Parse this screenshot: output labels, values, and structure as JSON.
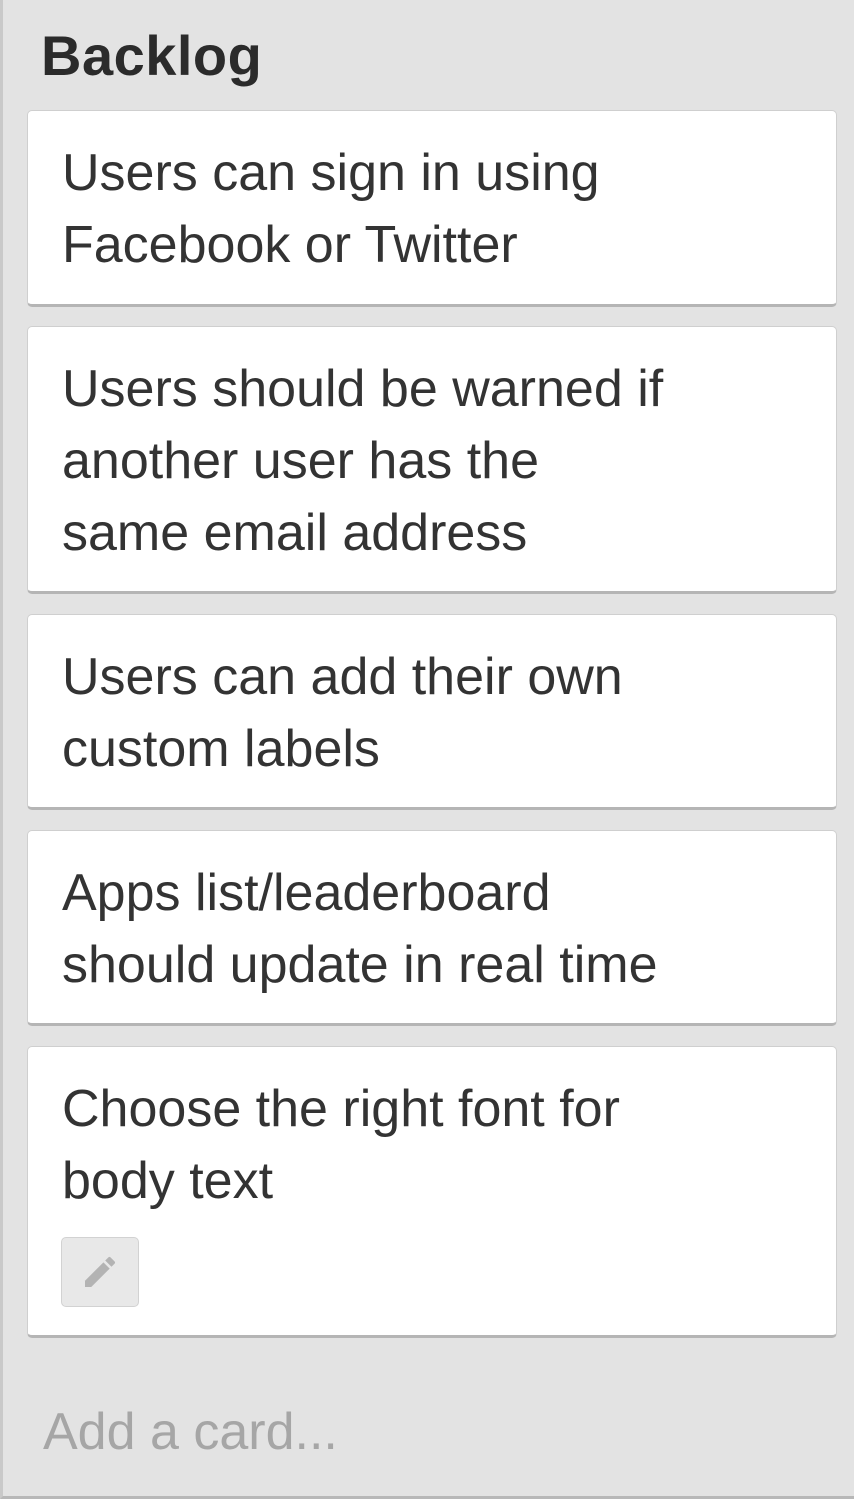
{
  "list": {
    "title": "Backlog",
    "cards": [
      {
        "text": "Users can sign in using\nFacebook or Twitter"
      },
      {
        "text": "Users should be warned if\nanother user has the\nsame email address"
      },
      {
        "text": "Users can add their own\ncustom labels"
      },
      {
        "text": "Apps list/leaderboard\nshould update in real time"
      },
      {
        "text": "Choose the right font for\nbody text",
        "edit_icon": "pencil-icon"
      }
    ],
    "add_card_label": "Add a card..."
  },
  "colors": {
    "list_background": "#e3e3e3",
    "card_background": "#ffffff",
    "text": "#333333",
    "muted_text": "#a6a6a6"
  }
}
